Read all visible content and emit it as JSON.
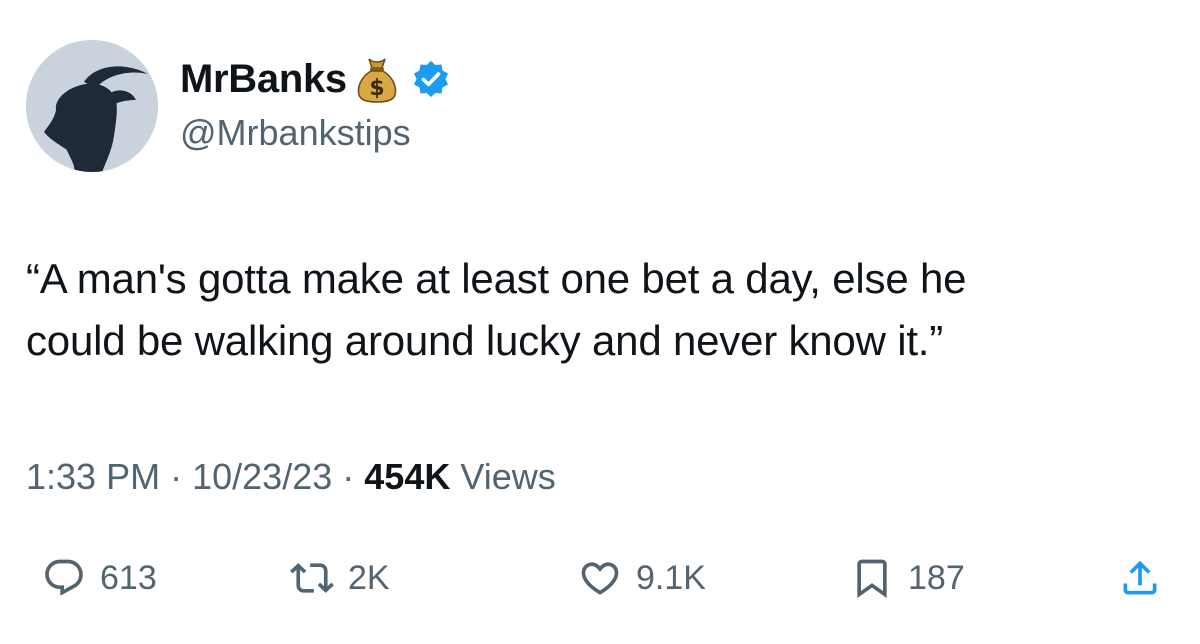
{
  "author": {
    "display_name": "MrBanks",
    "handle": "@Mrbankstips",
    "emoji_icon": "money-bag-icon",
    "verified_color": "#1d9bf0"
  },
  "tweet": {
    "lines": [
      "“A man's gotta make at least one bet a day, else he",
      "could be walking around lucky and never know it.”"
    ]
  },
  "meta": {
    "time": "1:33 PM",
    "separator": "·",
    "date": "10/23/23",
    "views_count": "454K",
    "views_label": "Views"
  },
  "actions": {
    "replies": "613",
    "retweets": "2K",
    "likes": "9.1K",
    "bookmarks": "187"
  },
  "colors": {
    "text_primary": "#0f1419",
    "text_secondary": "#536471",
    "verified_blue": "#1d9bf0"
  }
}
